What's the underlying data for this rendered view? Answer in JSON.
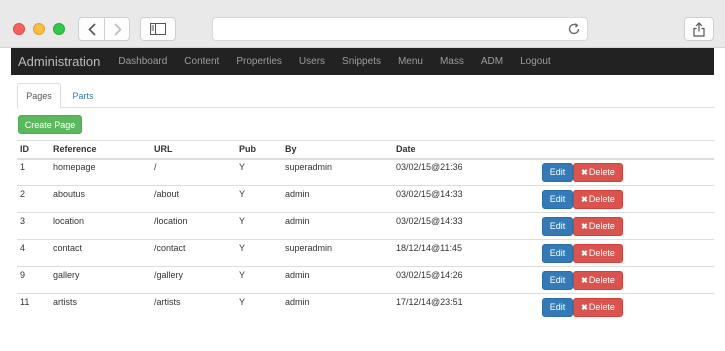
{
  "navbar": {
    "brand": "Administration",
    "links": [
      "Dashboard",
      "Content",
      "Properties",
      "Users",
      "Snippets",
      "Menu",
      "Mass",
      "ADM",
      "Logout"
    ]
  },
  "tabs": [
    {
      "label": "Pages",
      "active": true
    },
    {
      "label": "Parts",
      "active": false
    }
  ],
  "create_button": "Create Page",
  "table": {
    "headers": [
      "ID",
      "Reference",
      "URL",
      "Pub",
      "By",
      "Date"
    ],
    "rows": [
      {
        "id": "1",
        "reference": "homepage",
        "url": "/",
        "pub": "Y",
        "by": "superadmin",
        "date": "03/02/15@21:36"
      },
      {
        "id": "2",
        "reference": "aboutus",
        "url": "/about",
        "pub": "Y",
        "by": "admin",
        "date": "03/02/15@14:33"
      },
      {
        "id": "3",
        "reference": "location",
        "url": "/location",
        "pub": "Y",
        "by": "admin",
        "date": "03/02/15@14:33"
      },
      {
        "id": "4",
        "reference": "contact",
        "url": "/contact",
        "pub": "Y",
        "by": "superadmin",
        "date": "18/12/14@11:45"
      },
      {
        "id": "9",
        "reference": "gallery",
        "url": "/gallery",
        "pub": "Y",
        "by": "admin",
        "date": "03/02/15@14:26"
      },
      {
        "id": "11",
        "reference": "artists",
        "url": "/artists",
        "pub": "Y",
        "by": "admin",
        "date": "17/12/14@23:51"
      }
    ]
  },
  "row_actions": {
    "edit": "Edit",
    "delete": "Delete",
    "delete_icon": "✖"
  },
  "colors": {
    "navbar": "#222222",
    "create": "#5cb85c",
    "edit": "#337ab7",
    "delete": "#d9534f",
    "link": "#337ab7"
  }
}
